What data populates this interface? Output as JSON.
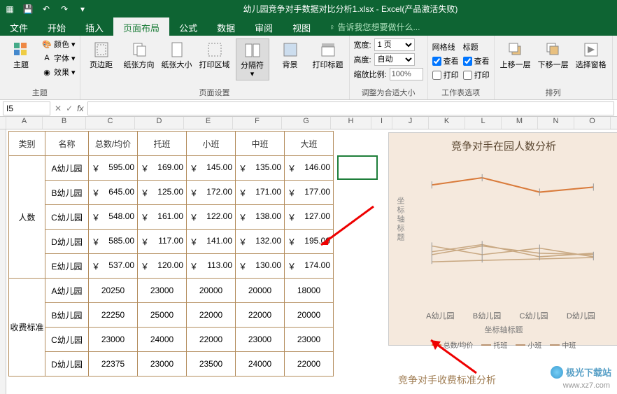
{
  "titlebar": {
    "title": "幼儿园竞争对手数据对比分析1.xlsx - Excel(产品激活失败)"
  },
  "menu": {
    "file": "文件",
    "home": "开始",
    "insert": "插入",
    "layout": "页面布局",
    "formula": "公式",
    "data": "数据",
    "review": "审阅",
    "view": "视图",
    "help": "告诉我您想要做什么..."
  },
  "ribbon": {
    "theme_group": "主题",
    "theme_btn": "主题",
    "color": "颜色",
    "font": "字体",
    "effect": "效果",
    "page_group": "页面设置",
    "margin": "页边距",
    "orient": "纸张方向",
    "size": "纸张大小",
    "area": "打印区域",
    "breaks": "分隔符",
    "bg": "背景",
    "titles": "打印标题",
    "scale_group": "调整为合适大小",
    "width": "宽度:",
    "height": "高度:",
    "zoom": "缩放比例:",
    "width_val": "1 页",
    "height_val": "自动",
    "zoom_val": "100%",
    "sheet_group": "工作表选项",
    "gridlines": "网格线",
    "headings": "标题",
    "view_chk": "查看",
    "print_chk": "打印",
    "arrange_group": "排列",
    "forward": "上移一层",
    "backward": "下移一层",
    "pane": "选择窗格"
  },
  "formula": {
    "cell": "I5",
    "fx": "fx"
  },
  "cols": [
    "A",
    "B",
    "C",
    "D",
    "E",
    "F",
    "G",
    "H",
    "I",
    "J",
    "K",
    "L",
    "M",
    "N",
    "O"
  ],
  "table": {
    "headers": [
      "类别",
      "名称",
      "总数/均价",
      "托班",
      "小班",
      "中班",
      "大班"
    ],
    "cat1": "人数",
    "cat2": "收费标准",
    "names": [
      "A幼儿园",
      "B幼儿园",
      "C幼儿园",
      "D幼儿园",
      "E幼儿园"
    ],
    "currency": "￥",
    "people": [
      [
        "595.00",
        "169.00",
        "145.00",
        "135.00",
        "146.00"
      ],
      [
        "645.00",
        "125.00",
        "172.00",
        "171.00",
        "177.00"
      ],
      [
        "548.00",
        "161.00",
        "122.00",
        "138.00",
        "127.00"
      ],
      [
        "585.00",
        "117.00",
        "141.00",
        "132.00",
        "195.00"
      ],
      [
        "537.00",
        "120.00",
        "113.00",
        "130.00",
        "174.00"
      ]
    ],
    "fees": [
      [
        "20250",
        "23000",
        "20000",
        "20000",
        "18000"
      ],
      [
        "22250",
        "25000",
        "22000",
        "22000",
        "20000"
      ],
      [
        "23000",
        "24000",
        "22000",
        "23000",
        "23000"
      ],
      [
        "22375",
        "23000",
        "23500",
        "24000",
        "22000"
      ]
    ],
    "fee_names": [
      "A幼儿园",
      "B幼儿园",
      "C幼儿园",
      "D幼儿园"
    ]
  },
  "chart_data": {
    "type": "line",
    "title": "竞争对手在园人数分析",
    "ylabel": "坐标轴标题",
    "xlabel": "坐标轴标题",
    "categories": [
      "A幼儿园",
      "B幼儿园",
      "C幼儿园",
      "D幼儿园"
    ],
    "series": [
      {
        "name": "总数/均价",
        "values": [
          595,
          645,
          548,
          585
        ],
        "color": "#d97b3b"
      },
      {
        "name": "托班",
        "values": [
          169,
          125,
          161,
          117
        ],
        "color": "#b8926f"
      },
      {
        "name": "小班",
        "values": [
          145,
          172,
          122,
          141
        ],
        "color": "#b8926f"
      },
      {
        "name": "中班",
        "values": [
          135,
          171,
          138,
          132
        ],
        "color": "#b8926f"
      }
    ],
    "ylim": [
      100,
      700
    ]
  },
  "chart2_title": "竞争对手收费标准分析",
  "watermark": {
    "text": "极光下载站",
    "url": "www.xz7.com"
  }
}
